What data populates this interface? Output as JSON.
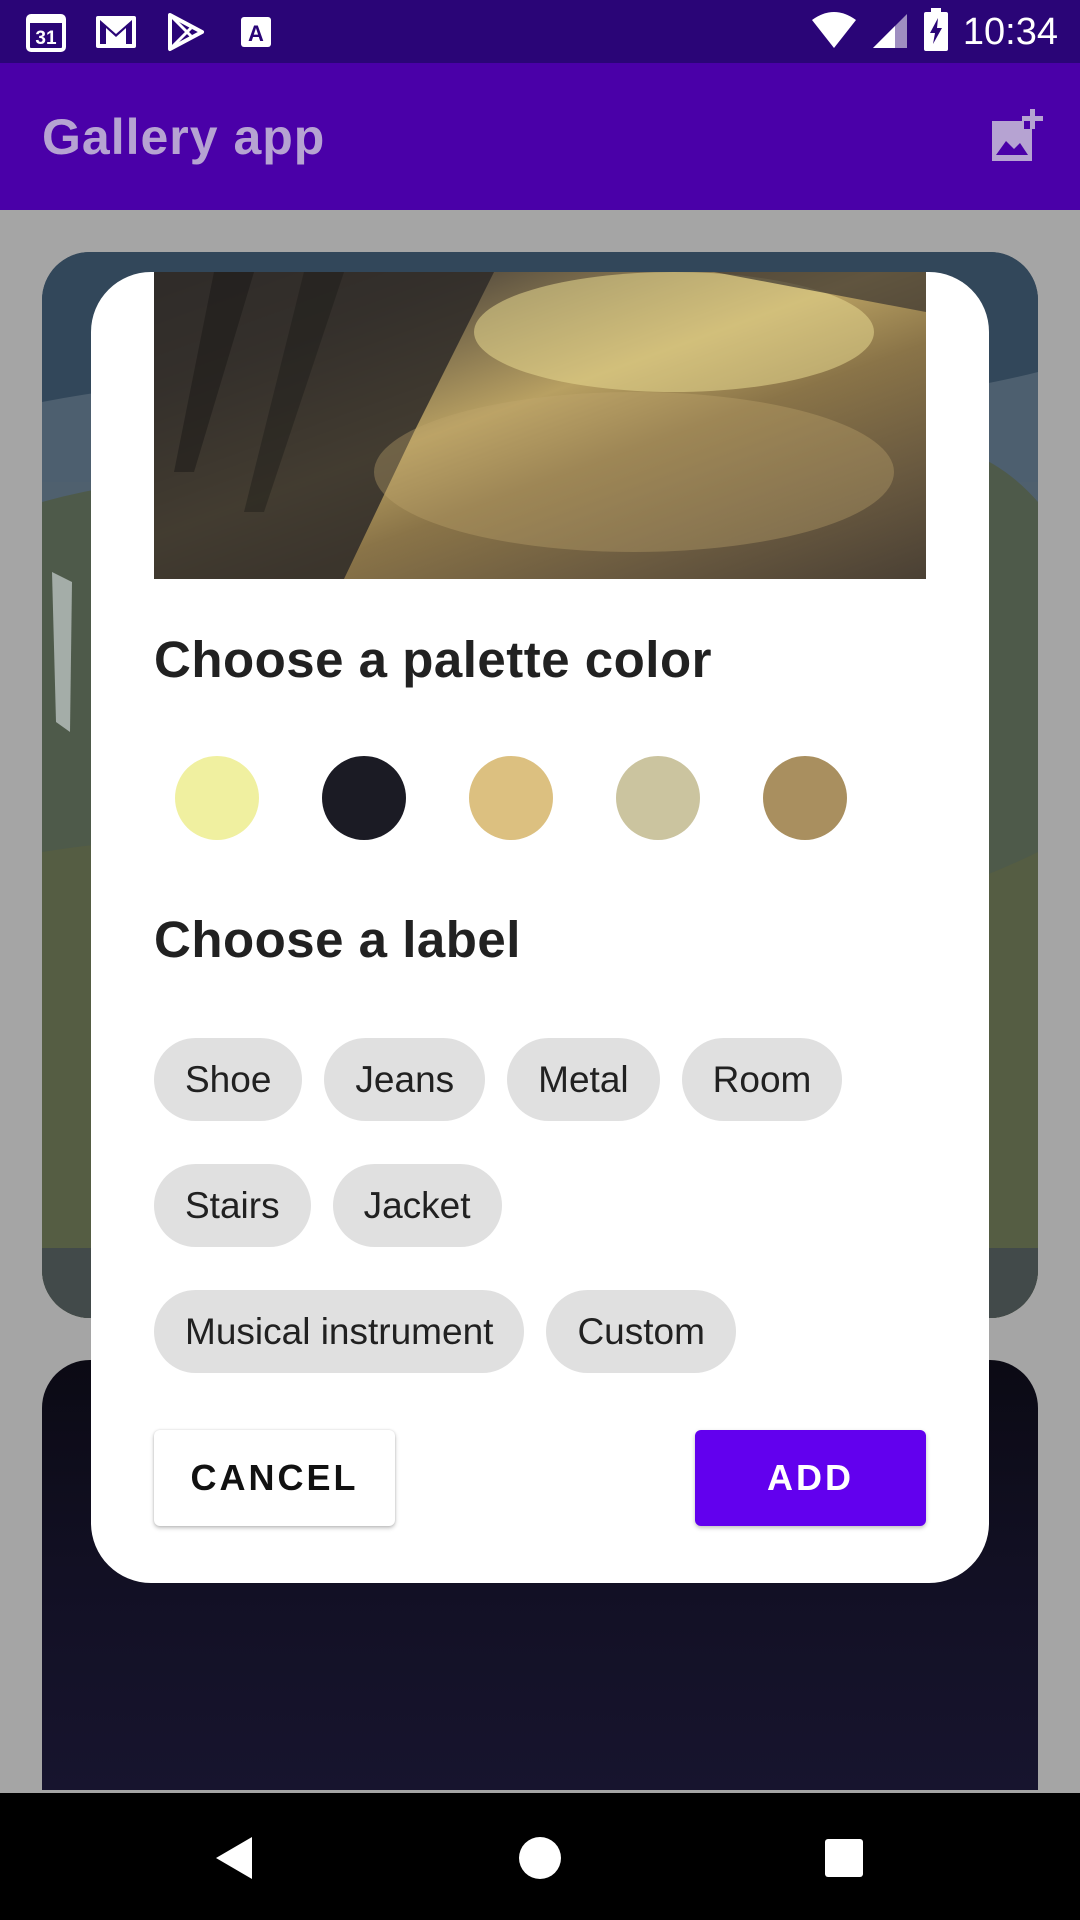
{
  "status_bar": {
    "time": "10:34",
    "calendar_day": "31",
    "icons": [
      "calendar-icon",
      "gmail-icon",
      "play-store-icon",
      "accessibility-icon",
      "wifi-icon",
      "signal-icon",
      "battery-charging-icon"
    ]
  },
  "app_bar": {
    "title": "Gallery app",
    "action_icon": "add-photo-icon"
  },
  "dialog": {
    "palette_title": "Choose a palette color",
    "palette_colors": [
      "#f0f0a0",
      "#1b1b24",
      "#dcc080",
      "#cbc49f",
      "#a98f5f"
    ],
    "label_title": "Choose a label",
    "chip_rows": [
      [
        "Shoe",
        "Jeans",
        "Metal",
        "Room"
      ],
      [
        "Stairs",
        "Jacket"
      ],
      [
        "Musical instrument",
        "Custom"
      ]
    ],
    "cancel_label": "CANCEL",
    "add_label": "ADD"
  },
  "colors": {
    "status_bar": "#2a0577",
    "app_bar": "#4a00a8",
    "primary_button": "#6200ee",
    "chip": "#e0e0e0"
  },
  "nav_bar": {
    "icons": [
      "back-icon",
      "home-icon",
      "recents-icon"
    ]
  }
}
